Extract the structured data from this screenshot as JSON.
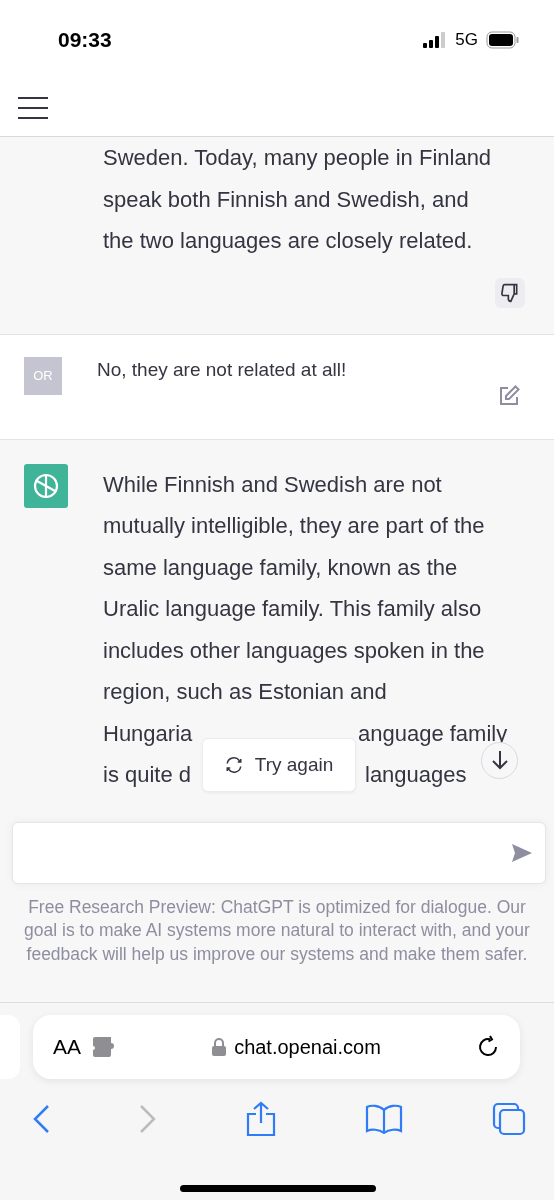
{
  "status_bar": {
    "time": "09:33",
    "network": "5G"
  },
  "messages": [
    {
      "kind": "assistant",
      "lines": [
        [
          "Sweden. Today, many people in Finland"
        ],
        [
          "speak both Finnish and Swedish, and"
        ],
        [
          "the two languages are closely related."
        ]
      ],
      "feedback": true
    },
    {
      "kind": "user",
      "avatar": "OR",
      "lines": [
        [
          "No, they are not related at all!"
        ]
      ],
      "editable": true
    },
    {
      "kind": "assistant",
      "lines": [
        [
          "While Finnish and Swedish are not"
        ],
        [
          "mutually intelligible, they are part of the"
        ],
        [
          "same language family, known as the"
        ],
        [
          "Uralic language family. This family also"
        ],
        [
          "includes other languages spoken in the"
        ],
        [
          "region, such as Estonian and"
        ],
        [
          "Hungaria",
          "anguage family"
        ],
        [
          "is quite d",
          "languages"
        ]
      ]
    }
  ],
  "try_again": "Try again",
  "disclaimer": "Free Research Preview: ChatGPT is optimized for dialogue. Our goal is to make AI systems more natural to interact with, and your feedback will help us improve our systems and make them safer.",
  "browser": {
    "text_size": "AA",
    "url": "chat.openai.com",
    "back_enabled": true,
    "forward_enabled": false
  }
}
